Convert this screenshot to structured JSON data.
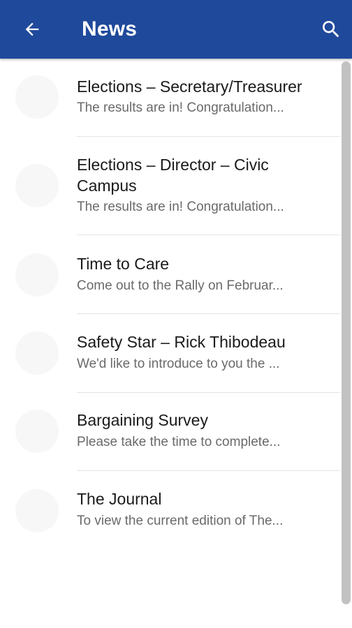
{
  "header": {
    "title": "News",
    "back_icon": "arrow-left-icon",
    "search_icon": "search-icon",
    "background_color": "#1f4a9b"
  },
  "news": {
    "items": [
      {
        "title": "Elections – Secretary/Treasurer",
        "snippet": "The results are in! Congratulation..."
      },
      {
        "title": "Elections – Director – Civic Campus",
        "snippet": "The results are in! Congratulation..."
      },
      {
        "title": "Time to Care",
        "snippet": "Come out to the Rally on Februar..."
      },
      {
        "title": "Safety Star – Rick Thibodeau",
        "snippet": "We'd like to introduce to you the ..."
      },
      {
        "title": "Bargaining Survey",
        "snippet": "Please take the time to complete..."
      },
      {
        "title": "The Journal",
        "snippet": "To view the current edition of The..."
      }
    ]
  }
}
